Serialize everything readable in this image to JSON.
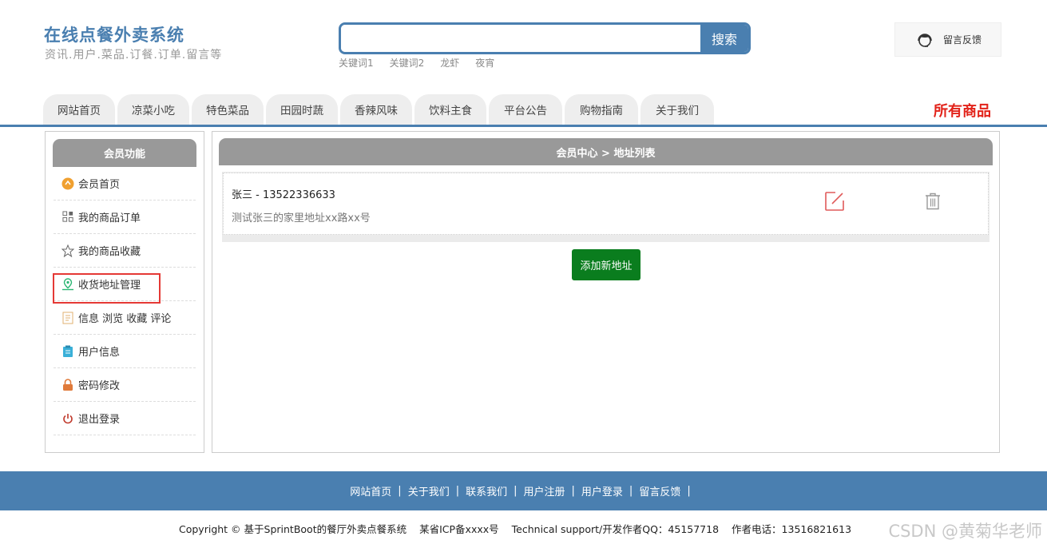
{
  "header": {
    "title": "在线点餐外卖系统",
    "subtitle": "资讯.用户.菜品.订餐.订单.留言等",
    "search_placeholder": "",
    "search_button": "搜索",
    "keywords": [
      "关键词1",
      "关键词2",
      "龙虾",
      "夜宵"
    ],
    "feedback_label": "留言反馈"
  },
  "nav": {
    "tabs": [
      "网站首页",
      "凉菜小吃",
      "特色菜品",
      "田园时蔬",
      "香辣风味",
      "饮料主食",
      "平台公告",
      "购物指南",
      "关于我们"
    ],
    "all_goods": "所有商品"
  },
  "sidebar": {
    "title": "会员功能",
    "items": [
      {
        "label": "会员首页",
        "icon": "member-home-icon",
        "color": "#f0a030"
      },
      {
        "label": "我的商品订单",
        "icon": "orders-grid-icon",
        "color": "#666666"
      },
      {
        "label": "我的商品收藏",
        "icon": "star-icon",
        "color": "#666666"
      },
      {
        "label": "收货地址管理",
        "icon": "location-pin-icon",
        "color": "#2bb673"
      },
      {
        "label": "信息 浏览 收藏 评论",
        "icon": "document-icon",
        "color": "#e0b070"
      },
      {
        "label": "用户信息",
        "icon": "clipboard-icon",
        "color": "#3ab0d8"
      },
      {
        "label": "密码修改",
        "icon": "lock-icon",
        "color": "#e07a3a"
      },
      {
        "label": "退出登录",
        "icon": "power-icon",
        "color": "#c0392b"
      }
    ]
  },
  "main": {
    "breadcrumb": "会员中心 > 地址列表",
    "address": {
      "name_phone": "张三 - 13522336633",
      "detail": "测试张三的家里地址xx路xx号"
    },
    "add_button": "添加新地址"
  },
  "footer": {
    "links": [
      "网站首页",
      "关于我们",
      "联系我们",
      "用户注册",
      "用户登录",
      "留言反馈"
    ],
    "separator": "|",
    "copyright": "Copyright © 基于SprintBoot的餐厅外卖点餐系统",
    "icp": "某省ICP备xxxx号",
    "support": "Technical support/开发作者QQ：45157718",
    "phone": "作者电话：13516821613",
    "watermark": "CSDN @黄菊华老师"
  },
  "colors": {
    "brand": "#4a7fb0",
    "all_goods": "#e2231a",
    "add_button": "#0a7d1e",
    "highlight_box": "#e53935"
  }
}
